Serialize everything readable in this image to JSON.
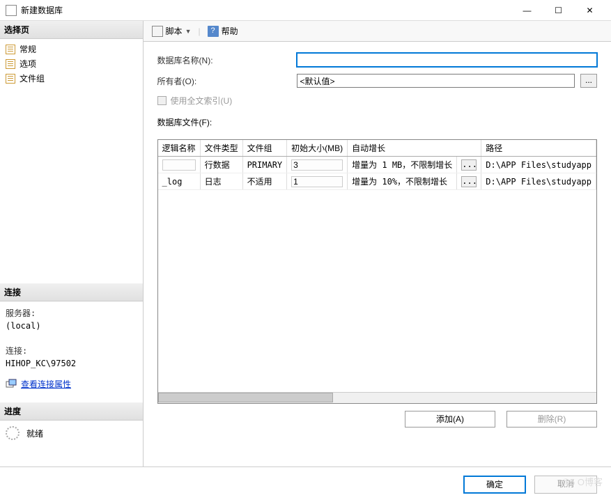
{
  "window": {
    "title": "新建数据库",
    "minimize": "—",
    "maximize": "☐",
    "close": "✕"
  },
  "sidebar": {
    "select_page_header": "选择页",
    "pages": [
      "常规",
      "选项",
      "文件组"
    ],
    "connection_header": "连接",
    "server_label": "服务器:",
    "server_value": "(local)",
    "conn_label": "连接:",
    "conn_value": "HIHOP_KC\\97502",
    "view_props_link": "查看连接属性",
    "progress_header": "进度",
    "ready_text": "就绪"
  },
  "toolbar": {
    "script_label": "脚本",
    "help_label": "帮助"
  },
  "form": {
    "db_name_label": "数据库名称(N):",
    "db_name_value": "",
    "owner_label": "所有者(O):",
    "owner_value": "<默认值>",
    "fulltext_label": "使用全文索引(U)",
    "files_label": "数据库文件(F):"
  },
  "grid": {
    "headers": {
      "logical_name": "逻辑名称",
      "file_type": "文件类型",
      "file_group": "文件组",
      "initial_size": "初始大小(MB)",
      "auto_growth": "自动增长",
      "path": "路径"
    },
    "rows": [
      {
        "logical_name": "",
        "file_type": "行数据",
        "file_group": "PRIMARY",
        "initial_size": "3",
        "auto_growth": "增量为 1 MB，不限制增长",
        "path": "D:\\APP Files\\studyapp"
      },
      {
        "logical_name": "_log",
        "file_type": "日志",
        "file_group": "不适用",
        "initial_size": "1",
        "auto_growth": "增量为 10%，不限制增长",
        "path": "D:\\APP Files\\studyapp"
      }
    ]
  },
  "buttons": {
    "add": "添加(A)",
    "remove": "删除(R)",
    "ok": "确定",
    "cancel": "取消"
  },
  "misc": {
    "dots": "...",
    "watermark": "@5  O博客"
  }
}
